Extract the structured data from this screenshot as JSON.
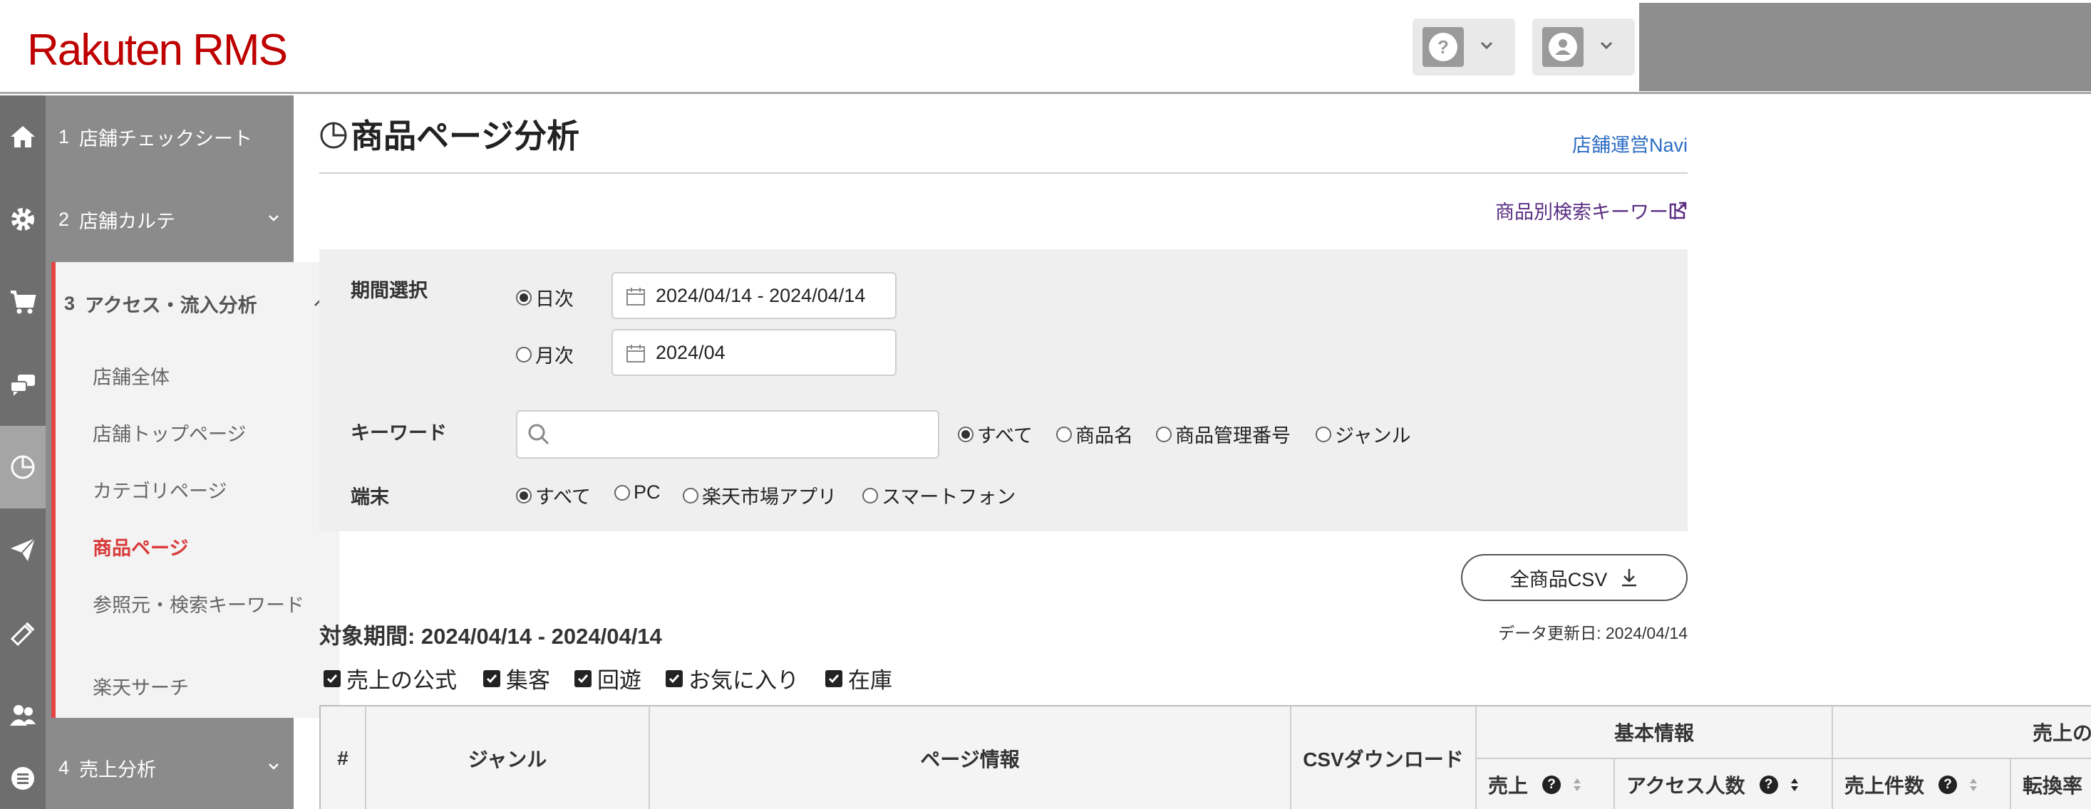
{
  "header": {
    "logo": "Rakuten RMS",
    "help_icon": "question-circle-icon",
    "user_icon": "user-avatar-icon"
  },
  "rail": {
    "icons": [
      "home-icon",
      "gear-icon",
      "cart-icon",
      "chat-icon",
      "pie-chart-icon",
      "send-icon",
      "megaphone-icon",
      "people-icon",
      "list-icon"
    ]
  },
  "sidebar": {
    "items": [
      {
        "num": "1",
        "label": "店舗チェックシート"
      },
      {
        "num": "2",
        "label": "店舗カルテ"
      },
      {
        "num": "3",
        "label": "アクセス・流入分析"
      },
      {
        "num": "4",
        "label": "売上分析"
      }
    ],
    "sub_items": [
      "店舗全体",
      "店舗トップページ",
      "カテゴリページ",
      "商品ページ",
      "参照元・検索キーワード",
      "楽天サーチ"
    ]
  },
  "main": {
    "title": "商品ページ分析",
    "navi_link": "店舗運営Navi",
    "keyword_link": "商品別検索キーワード",
    "filters": {
      "period_label": "期間選択",
      "daily_label": "日次",
      "daily_value": "2024/04/14 - 2024/04/14",
      "monthly_label": "月次",
      "monthly_value": "2024/04",
      "keyword_label": "キーワード",
      "keyword_value": "",
      "keyword_options": [
        "すべて",
        "商品名",
        "商品管理番号",
        "ジャンル"
      ],
      "device_label": "端末",
      "device_options": [
        "すべて",
        "PC",
        "楽天市場アプリ",
        "スマートフォン"
      ]
    },
    "csv_button": "全商品CSV",
    "period_text": "対象期間: 2024/04/14 - 2024/04/14",
    "updated_text": "データ更新日: 2024/04/14",
    "checkboxes": [
      "売上の公式",
      "集客",
      "回遊",
      "お気に入り",
      "在庫"
    ],
    "table": {
      "headers": [
        "#",
        "ジャンル",
        "ページ情報",
        "CSVダウンロード"
      ],
      "group_basic": "基本情報",
      "group_sales": "売上の",
      "sub_headers": [
        "売上",
        "アクセス人数",
        "売上件数",
        "転換率"
      ],
      "help_mark": "?"
    }
  },
  "colors": {
    "brand": "#bf0000",
    "active_menu": "#d93a3a",
    "link": "#2b6cc4",
    "visited_link": "#5a2d82"
  }
}
